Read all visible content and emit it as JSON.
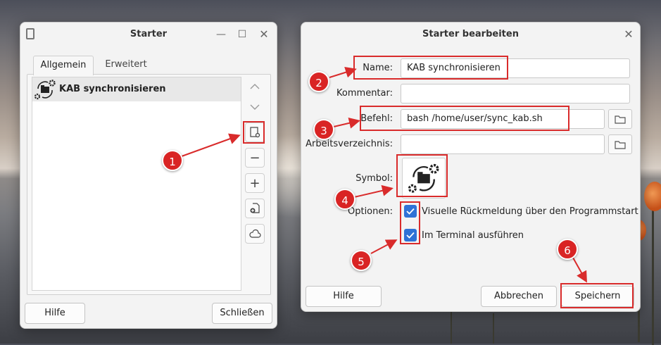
{
  "starter_window": {
    "title": "Starter",
    "tabs": [
      {
        "label": "Allgemein"
      },
      {
        "label": "Erweitert"
      }
    ],
    "list": [
      {
        "label": "KAB synchronisieren"
      }
    ],
    "footer": {
      "help": "Hilfe",
      "close": "Schließen"
    }
  },
  "edit_dialog": {
    "title": "Starter bearbeiten",
    "fields": {
      "name": {
        "label": "Name:",
        "value": "KAB synchronisieren"
      },
      "comment": {
        "label": "Kommentar:",
        "value": ""
      },
      "command": {
        "label": "Befehl:",
        "value": "bash /home/user/sync_kab.sh"
      },
      "workdir": {
        "label": "Arbeitsverzeichnis:",
        "value": ""
      },
      "icon": {
        "label": "Symbol:"
      }
    },
    "options": {
      "label": "Optionen:",
      "items": [
        {
          "label": "Visuelle Rückmeldung über den Programmstart",
          "checked": true
        },
        {
          "label": "Im Terminal ausführen",
          "checked": true
        }
      ]
    },
    "footer": {
      "help": "Hilfe",
      "cancel": "Abbrechen",
      "save": "Speichern"
    }
  },
  "annotations": {
    "color": "#d92b2b",
    "badges": [
      "1",
      "2",
      "3",
      "4",
      "5",
      "6"
    ]
  }
}
